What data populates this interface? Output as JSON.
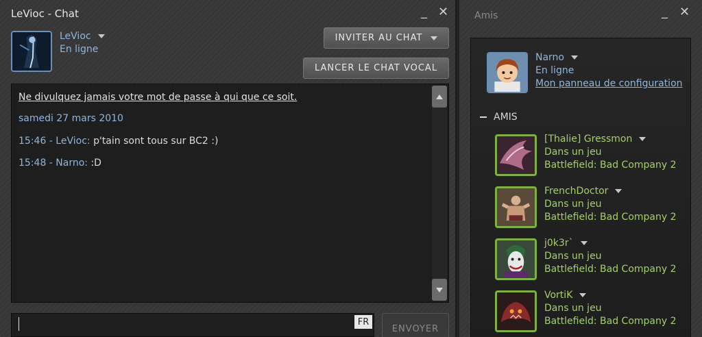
{
  "chat_window": {
    "title": "LeVioc - Chat",
    "user": {
      "name": "LeVioc",
      "status": "En ligne"
    },
    "invite_button": "INVITER AU CHAT",
    "voice_button": "LANCER LE CHAT VOCAL",
    "log": {
      "warning": "Ne divulquez jamais votre mot de passe à qui que ce soit.",
      "date": "samedi 27 mars 2010",
      "messages": [
        {
          "meta": "15:46 - LeVioc:",
          "text": "p'tain sont tous sur BC2 :)"
        },
        {
          "meta": "15:48 - Narno:",
          "text": ":D"
        }
      ]
    },
    "input": {
      "value": "",
      "lang": "FR"
    },
    "send_button": "ENVOYER"
  },
  "friends_window": {
    "title": "Amis",
    "me": {
      "name": "Narno",
      "status": "En ligne",
      "config_link": "Mon panneau de configuration"
    },
    "section_label": "AMIS",
    "friends": [
      {
        "name": "[Thalie] Gressmon",
        "status": "Dans un jeu",
        "game": "Battlefield: Bad Company 2"
      },
      {
        "name": "FrenchDoctor",
        "status": "Dans un jeu",
        "game": "Battlefield: Bad Company 2"
      },
      {
        "name": "j0k3r`",
        "status": "Dans un jeu",
        "game": "Battlefield: Bad Company 2"
      },
      {
        "name": "VortiK",
        "status": "Dans un jeu",
        "game": "Battlefield: Bad Company 2"
      }
    ]
  },
  "window_controls": {
    "minimize": "_",
    "close": "✕"
  },
  "colors": {
    "accent_blue": "#8fb6dd",
    "ingame_green": "#a5cf6a",
    "avatar_border_green": "#7fb044"
  }
}
